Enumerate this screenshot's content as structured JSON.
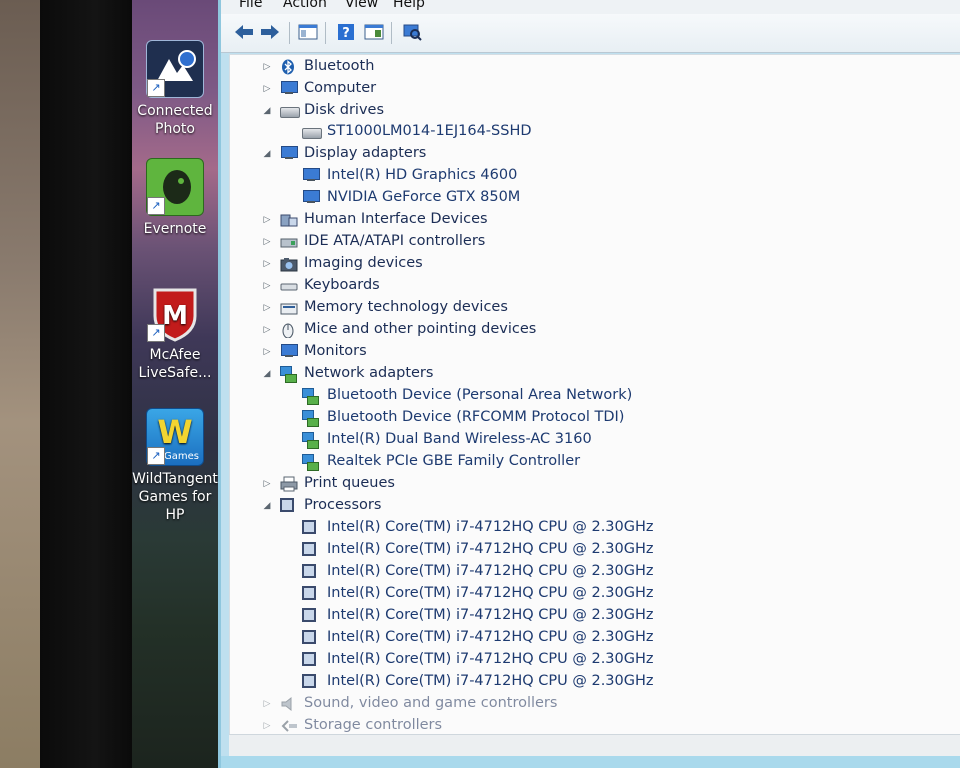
{
  "menu": {
    "file": "File",
    "action": "Action",
    "view": "View",
    "help": "Help"
  },
  "toolbar": {
    "icons": [
      "back-arrow-icon",
      "forward-arrow-icon",
      "show-hide-console-tree-icon",
      "help-icon",
      "properties-icon",
      "scan-hardware-icon"
    ]
  },
  "desktop": {
    "icons": [
      {
        "line1": "Connected",
        "line2": "Photo"
      },
      {
        "line1": "Evernote",
        "line2": ""
      },
      {
        "line1": "McAfee",
        "line2": "LiveSafe..."
      },
      {
        "line1": "WildTangent",
        "line2": "Games for HP",
        "badge": "Games"
      }
    ]
  },
  "tree": {
    "bluetooth": "Bluetooth",
    "computer": "Computer",
    "disk_drives": {
      "label": "Disk drives",
      "children": [
        "ST1000LM014-1EJ164-SSHD"
      ]
    },
    "display_adapters": {
      "label": "Display adapters",
      "children": [
        "Intel(R) HD Graphics 4600",
        "NVIDIA GeForce GTX 850M"
      ]
    },
    "hid": "Human Interface Devices",
    "ide": "IDE ATA/ATAPI controllers",
    "imaging": "Imaging devices",
    "keyboards": "Keyboards",
    "memory": "Memory technology devices",
    "mice": "Mice and other pointing devices",
    "monitors": "Monitors",
    "network_adapters": {
      "label": "Network adapters",
      "children": [
        "Bluetooth Device (Personal Area Network)",
        "Bluetooth Device (RFCOMM Protocol TDI)",
        "Intel(R) Dual Band Wireless-AC 3160",
        "Realtek PCIe GBE Family Controller"
      ]
    },
    "print_queues": "Print queues",
    "processors": {
      "label": "Processors",
      "children": [
        "Intel(R) Core(TM) i7-4712HQ CPU @ 2.30GHz",
        "Intel(R) Core(TM) i7-4712HQ CPU @ 2.30GHz",
        "Intel(R) Core(TM) i7-4712HQ CPU @ 2.30GHz",
        "Intel(R) Core(TM) i7-4712HQ CPU @ 2.30GHz",
        "Intel(R) Core(TM) i7-4712HQ CPU @ 2.30GHz",
        "Intel(R) Core(TM) i7-4712HQ CPU @ 2.30GHz",
        "Intel(R) Core(TM) i7-4712HQ CPU @ 2.30GHz",
        "Intel(R) Core(TM) i7-4712HQ CPU @ 2.30GHz"
      ]
    },
    "sound": "Sound, video and game controllers",
    "storage": "Storage controllers"
  },
  "colors": {
    "window_frame": "#bfe0ef",
    "tree_text": "#1d3a70",
    "tree_bg": "#fbfbfb"
  }
}
